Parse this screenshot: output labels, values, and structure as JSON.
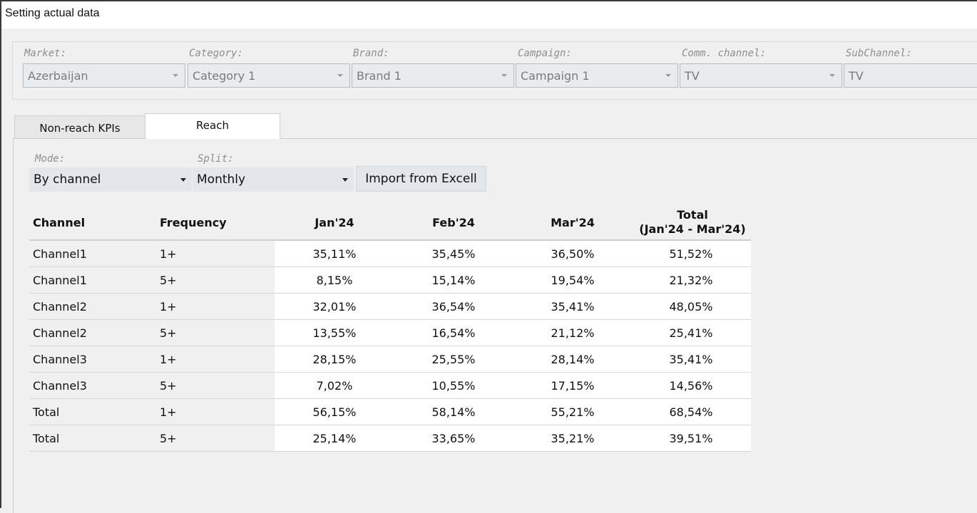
{
  "window": {
    "title": "Setting actual data"
  },
  "filters": [
    {
      "label": "Market:",
      "value": "Azerbaijan"
    },
    {
      "label": "Category:",
      "value": "Category 1"
    },
    {
      "label": "Brand:",
      "value": "Brand 1"
    },
    {
      "label": "Campaign:",
      "value": "Campaign 1"
    },
    {
      "label": "Comm. channel:",
      "value": "TV"
    },
    {
      "label": "SubChannel:",
      "value": "TV"
    }
  ],
  "tabs": [
    {
      "label": "Non-reach KPIs",
      "active": false
    },
    {
      "label": "Reach",
      "active": true
    }
  ],
  "controls": {
    "mode": {
      "label": "Mode:",
      "value": "By channel"
    },
    "split": {
      "label": "Split:",
      "value": "Monthly"
    },
    "import_label": "Import from Excell"
  },
  "table": {
    "headers": {
      "channel": "Channel",
      "frequency": "Frequency",
      "jan": "Jan'24",
      "feb": "Feb'24",
      "mar": "Mar'24",
      "total_line1": "Total",
      "total_line2": "(Jan'24 - Mar'24)"
    },
    "rows": [
      {
        "channel": "Channel1",
        "frequency": "1+",
        "jan": "35,11%",
        "feb": "35,45%",
        "mar": "36,50%",
        "total": "51,52%"
      },
      {
        "channel": "Channel1",
        "frequency": "5+",
        "jan": "8,15%",
        "feb": "15,14%",
        "mar": "19,54%",
        "total": "21,32%"
      },
      {
        "channel": "Channel2",
        "frequency": "1+",
        "jan": "32,01%",
        "feb": "36,54%",
        "mar": "35,41%",
        "total": "48,05%"
      },
      {
        "channel": "Channel2",
        "frequency": "5+",
        "jan": "13,55%",
        "feb": "16,54%",
        "mar": "21,12%",
        "total": "25,41%"
      },
      {
        "channel": "Channel3",
        "frequency": "1+",
        "jan": "28,15%",
        "feb": "25,55%",
        "mar": "28,14%",
        "total": "35,41%"
      },
      {
        "channel": "Channel3",
        "frequency": "5+",
        "jan": "7,02%",
        "feb": "10,55%",
        "mar": "17,15%",
        "total": "14,56%"
      },
      {
        "channel": "Total",
        "frequency": "1+",
        "jan": "56,15%",
        "feb": "58,14%",
        "mar": "55,21%",
        "total": "68,54%"
      },
      {
        "channel": "Total",
        "frequency": "5+",
        "jan": "25,14%",
        "feb": "33,65%",
        "mar": "35,21%",
        "total": "39,51%"
      }
    ]
  }
}
